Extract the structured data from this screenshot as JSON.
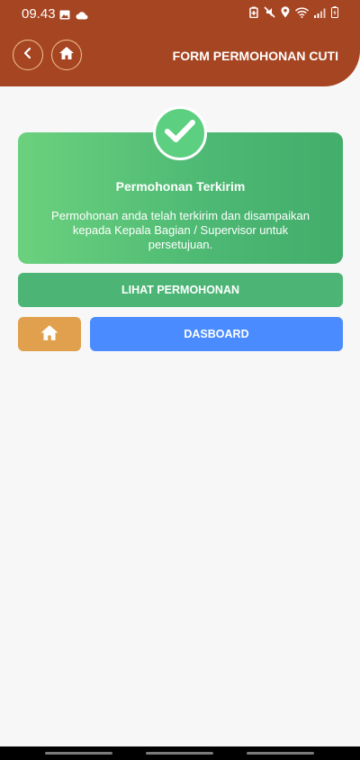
{
  "statusbar": {
    "time": "09.43"
  },
  "header": {
    "title": "FORM PERMOHONAN CUTI"
  },
  "card": {
    "title": "Permohonan Terkirim",
    "message": "Permohonan anda telah terkirim dan disampaikan kepada Kepala Bagian / Supervisor untuk persetujuan."
  },
  "buttons": {
    "view_label": "LIHAT PERMOHONAN",
    "dashboard_label": "DASBOARD"
  },
  "colors": {
    "header": "#a64522",
    "success": "#4cb575",
    "home_button": "#e0a04d",
    "dashboard_button": "#4a8cff"
  },
  "icons": [
    "image-icon",
    "cloud-icon",
    "battery-saver-icon",
    "mute-icon",
    "location-icon",
    "wifi-icon",
    "signal-icon",
    "battery-icon",
    "back-icon",
    "home-icon",
    "check-icon"
  ]
}
